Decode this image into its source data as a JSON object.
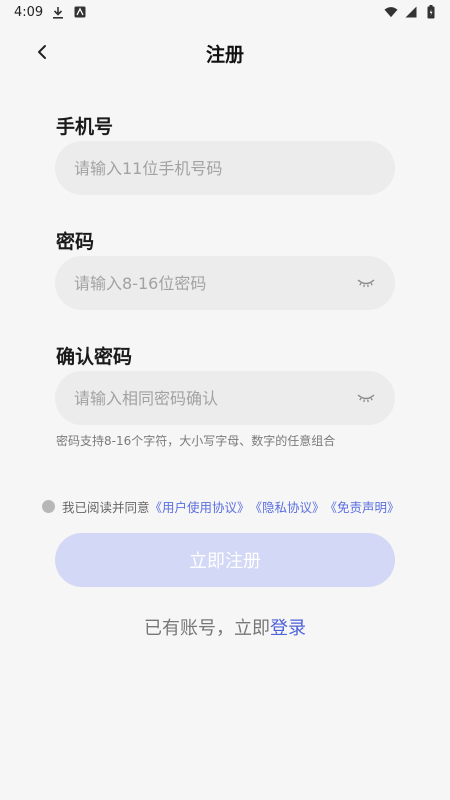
{
  "status_bar": {
    "time": "4:09",
    "left_icons": [
      "download-icon",
      "app-notification-icon"
    ],
    "right_icons": [
      "wifi-icon",
      "signal-icon",
      "battery-icon"
    ]
  },
  "nav": {
    "title": "注册",
    "back_icon": "chevron-left-icon"
  },
  "form": {
    "phone": {
      "label": "手机号",
      "placeholder": "请输入11位手机号码",
      "value": ""
    },
    "password": {
      "label": "密码",
      "placeholder": "请输入8-16位密码",
      "value": "",
      "toggle_icon": "eye-closed-icon"
    },
    "confirm_password": {
      "label": "确认密码",
      "placeholder": "请输入相同密码确认",
      "value": "",
      "toggle_icon": "eye-closed-icon"
    },
    "hint": "密码支持8-16个字符，大小写字母、数字的任意组合"
  },
  "agreement": {
    "prefix": "我已阅读并同意",
    "links": [
      "《用户使用协议》",
      "《隐私协议》",
      "《免责声明》"
    ],
    "checked": false
  },
  "register_button": {
    "label": "立即注册",
    "enabled": false
  },
  "login_prompt": {
    "text": "已有账号，立即",
    "link": "登录"
  },
  "colors": {
    "background": "#f6f6f6",
    "input_bg": "#ececec",
    "accent": "#4d62d9",
    "button_disabled": "#d3d8f6"
  }
}
